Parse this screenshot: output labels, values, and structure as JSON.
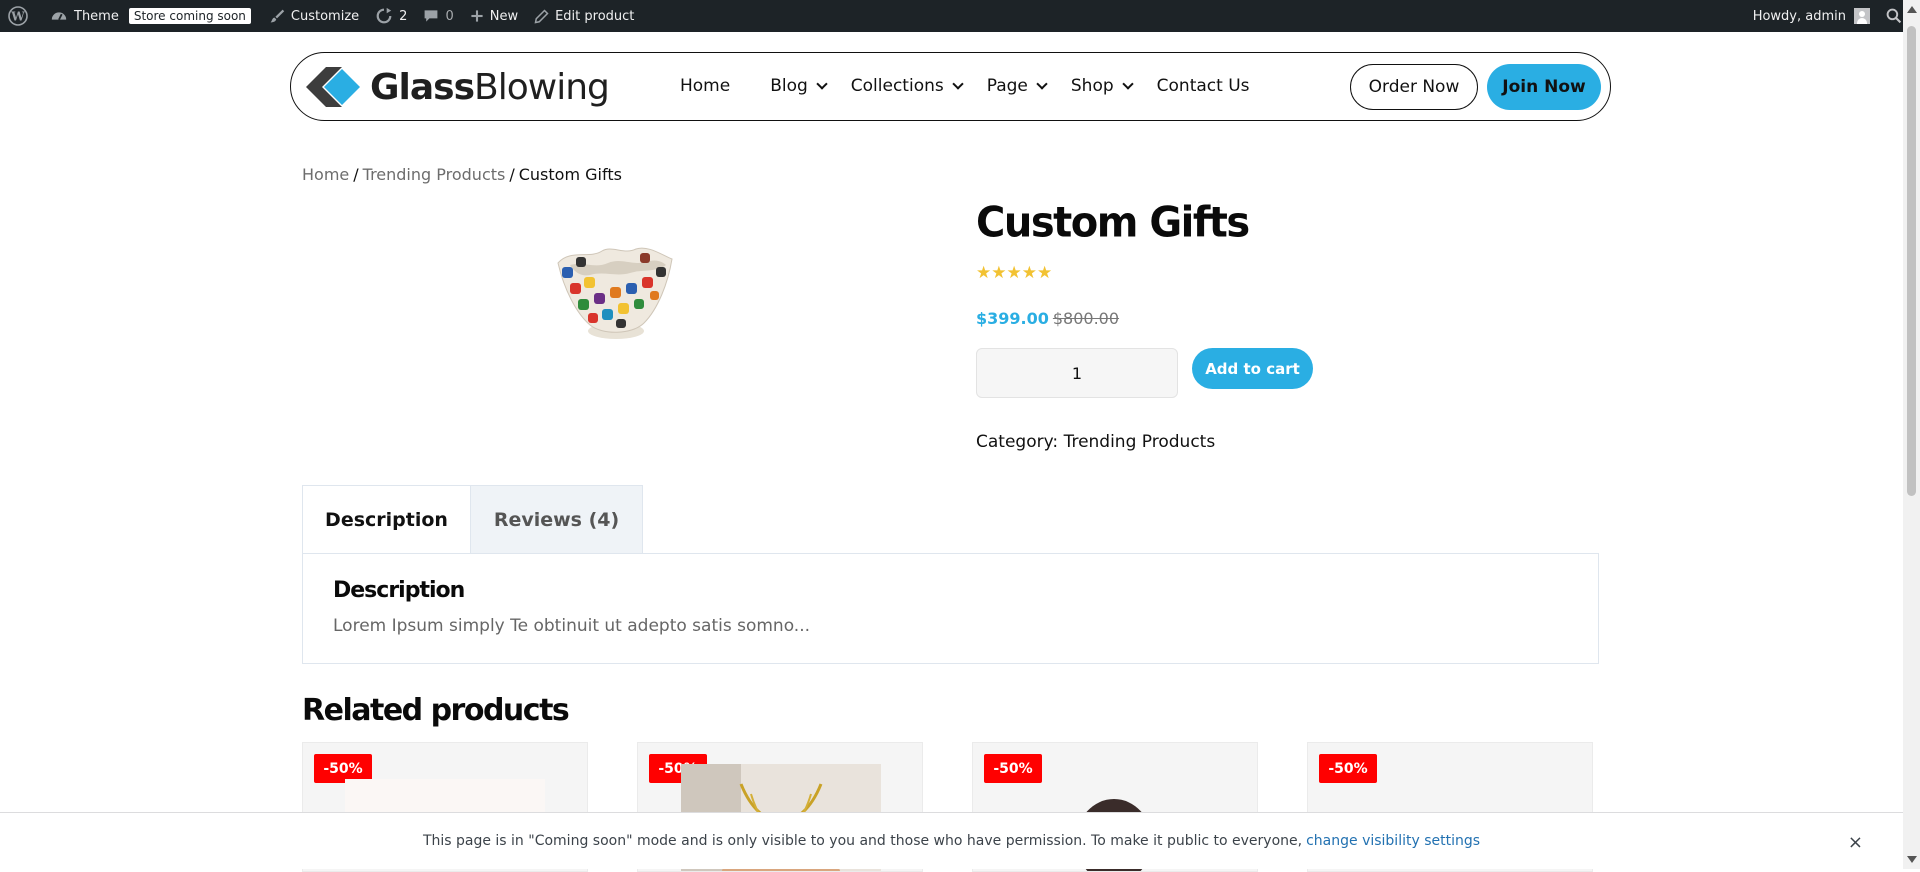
{
  "admin_bar": {
    "site_name": "Theme",
    "store_badge": "Store coming soon",
    "customize": "Customize",
    "updates_count": "2",
    "comments_count": "0",
    "new": "New",
    "edit": "Edit product",
    "howdy": "Howdy, admin"
  },
  "header": {
    "logo_bold": "Glass",
    "logo_light": "Blowing",
    "nav": [
      {
        "label": "Home",
        "dropdown": false
      },
      {
        "label": "Blog",
        "dropdown": true
      },
      {
        "label": "Collections",
        "dropdown": true
      },
      {
        "label": "Page",
        "dropdown": true
      },
      {
        "label": "Shop",
        "dropdown": true
      },
      {
        "label": "Contact Us",
        "dropdown": false
      }
    ],
    "order_button": "Order Now",
    "join_button": "Join Now"
  },
  "breadcrumb": {
    "home": "Home",
    "category": "Trending Products",
    "current": "Custom Gifts",
    "separator": "/"
  },
  "product": {
    "title": "Custom Gifts",
    "rating": 5,
    "sale_price": "$399.00",
    "regular_price": "$800.00",
    "quantity": "1",
    "add_to_cart": "Add to cart",
    "category_label": "Category:",
    "category": "Trending Products"
  },
  "tabs": {
    "description_tab": "Description",
    "reviews_tab": "Reviews (4)",
    "panel_title": "Description",
    "panel_text": "Lorem Ipsum simply Te obtinuit ut adepto satis somno..."
  },
  "related": {
    "title": "Related products",
    "badges": [
      "-50%",
      "-50%",
      "-50%",
      "-50%"
    ]
  },
  "coming_soon": {
    "message": "This page is in \"Coming soon\" mode and is only visible to you and those who have permission. To make it public to everyone,",
    "link": "change visibility settings",
    "close": "×"
  },
  "colors": {
    "accent": "#2aaee3",
    "sale_badge": "#ff0000",
    "star": "#f2c232",
    "admin_bar": "#1d2327"
  }
}
